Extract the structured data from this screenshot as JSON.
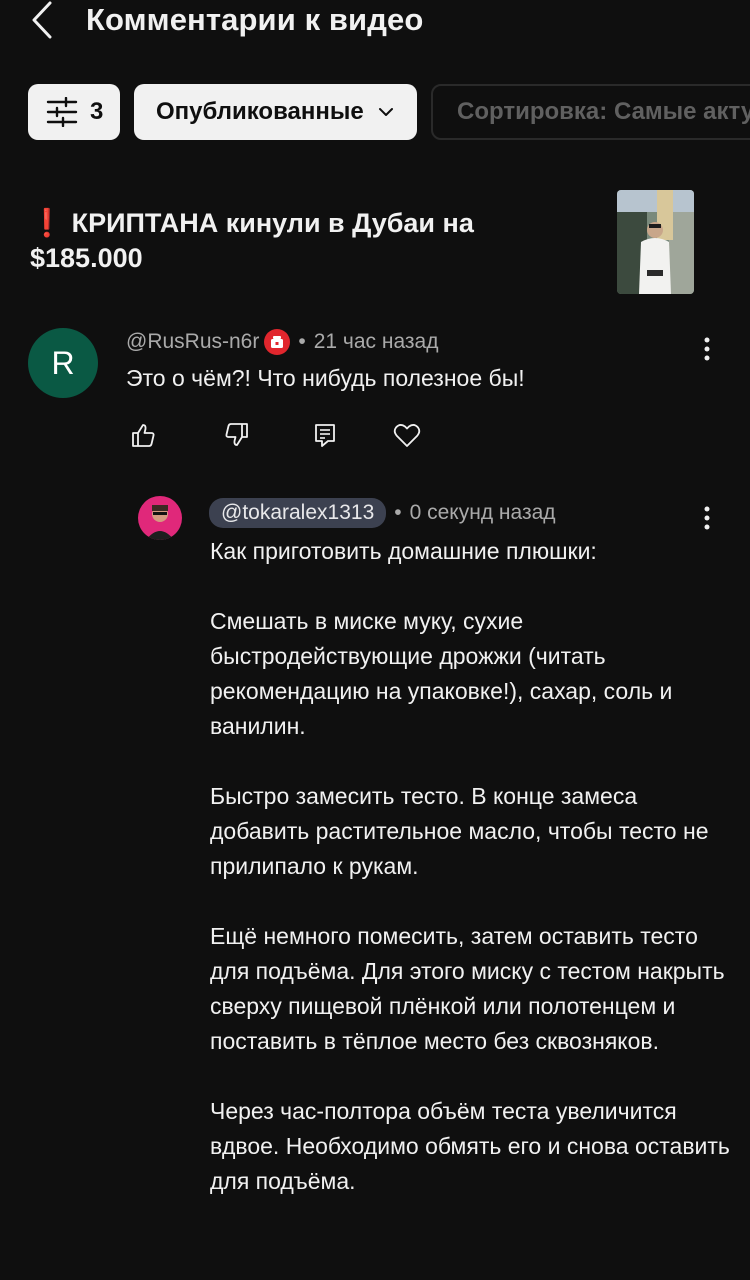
{
  "header": {
    "title": "Комментарии к видео"
  },
  "filters": {
    "filter_count": "3",
    "status_label": "Опубликованные",
    "sort_label": "Сортировка: Самые актуальные"
  },
  "video": {
    "title_marker": "❗",
    "title": "КРИПТАНА кинули в Дубаи на $185.000"
  },
  "comment": {
    "avatar_letter": "R",
    "author": "@RusRus-n6r",
    "time": "21 час назад",
    "text": "Это о чём?! Что нибудь полезное бы!"
  },
  "reply": {
    "author": "@tokaralex1313",
    "time": "0 секунд назад",
    "paragraphs": [
      "Как приготовить домашние плюшки:",
      "Смешать в миске муку, сухие быстродействующие дрожжи (читать рекомендацию на упаковке!), сахар, соль и ванилин.",
      "Быстро замесить тесто. В конце замеса добавить растительное масло, чтобы тесто не прилипало к рукам.",
      "Ещё немного помесить, затем оставить тесто для подъёма. Для этого миску с тестом накрыть сверху пищевой плёнкой или полотенцем и поставить в тёплое место без сквозняков.",
      "Через час-полтора объём теста увеличится вдвое. Необходимо обмять его и снова оставить для подъёма."
    ]
  },
  "icons": {
    "back": "chevron-left-icon",
    "filter": "sliders-icon",
    "dropdown": "chevron-down-icon",
    "badge": "member-badge-icon",
    "more": "more-vertical-icon",
    "like": "thumbs-up-icon",
    "dislike": "thumbs-down-icon",
    "reply": "reply-icon",
    "heart": "heart-icon"
  },
  "colors": {
    "background": "#0f0f0f",
    "text": "#f1f1f1",
    "secondary_text": "#aaaaaa",
    "avatar": "#0a5944",
    "badge": "#e1262d",
    "handle_pill": "#3c4150",
    "title_marker": "#e0201c"
  }
}
